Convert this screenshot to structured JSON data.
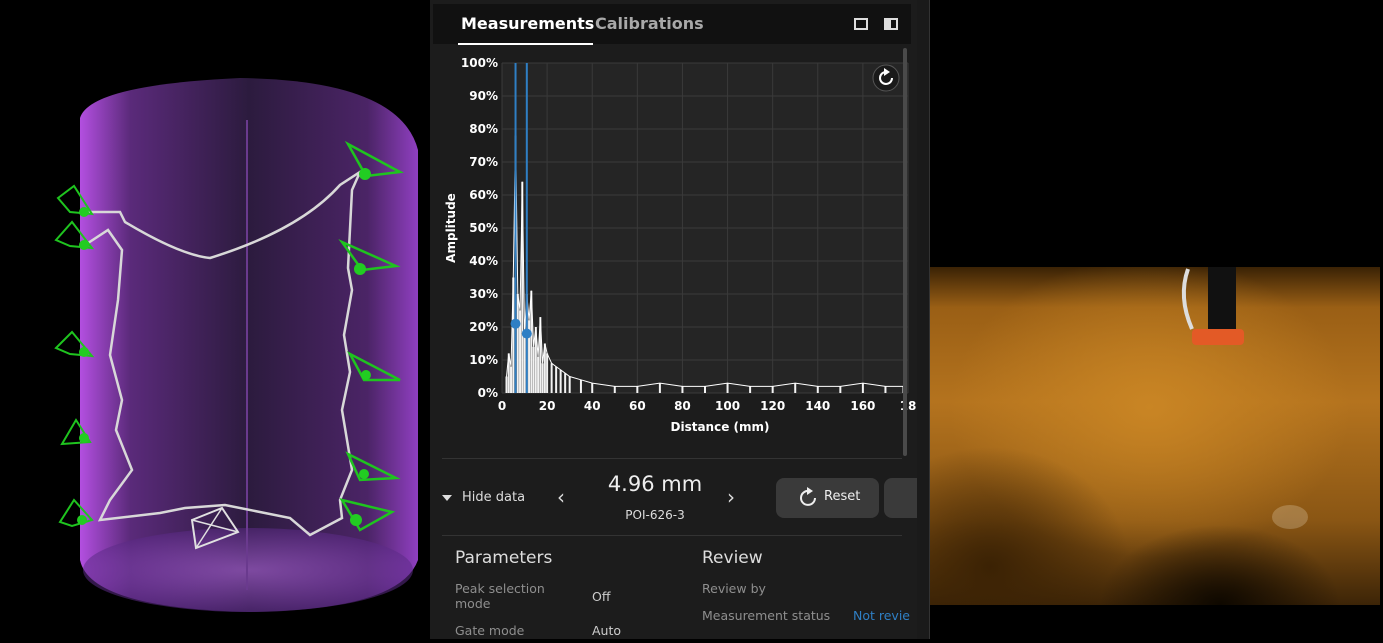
{
  "tabs": {
    "measurements": "Measurements",
    "calibrations": "Calibrations"
  },
  "chart_data": {
    "type": "line",
    "xlabel": "Distance (mm)",
    "ylabel": "Amplitude",
    "xlim": [
      0,
      180
    ],
    "ylim": [
      0,
      100
    ],
    "x_ticks": [
      "0",
      "20",
      "40",
      "60",
      "80",
      "100",
      "120",
      "140",
      "160",
      "18"
    ],
    "y_ticks": [
      "0%",
      "10%",
      "20%",
      "30%",
      "40%",
      "50%",
      "60%",
      "70%",
      "80%",
      "90%",
      "100%"
    ],
    "grid": true,
    "gate_lines_mm": [
      6,
      11
    ],
    "peaks": [
      {
        "x": 6,
        "y": 21
      },
      {
        "x": 11,
        "y": 18
      }
    ],
    "series": [
      {
        "x": [
          2,
          3,
          4,
          5,
          6,
          7,
          8,
          9,
          10,
          11,
          12,
          13,
          14,
          15,
          16,
          17,
          18,
          19,
          20,
          22,
          24,
          26,
          28,
          30,
          35,
          40,
          50,
          60,
          70,
          80,
          90,
          100,
          110,
          120,
          130,
          140,
          150,
          160,
          170,
          178
        ],
        "y": [
          5,
          12,
          8,
          35,
          78,
          30,
          25,
          64,
          18,
          30,
          22,
          31,
          14,
          20,
          11,
          23,
          9,
          15,
          12,
          9,
          8,
          7,
          6,
          5,
          4,
          3,
          2,
          2,
          3,
          2,
          2,
          3,
          2,
          2,
          3,
          2,
          2,
          3,
          2,
          2
        ]
      }
    ]
  },
  "measurement": {
    "value": "4.96 mm",
    "poi": "POI-626-3"
  },
  "controls": {
    "hide_data": "Hide data",
    "reset": "Reset"
  },
  "parameters": {
    "title": "Parameters",
    "peak_selection_label": "Peak selection mode",
    "peak_selection_value": "Off",
    "gate_mode_label": "Gate mode",
    "gate_mode_value": "Auto"
  },
  "review": {
    "title": "Review",
    "review_by_label": "Review by",
    "status_label": "Measurement status",
    "status_value": "Not reviewed"
  },
  "colors": {
    "accent": "#2f7fc4",
    "poi_green": "#22cc22",
    "pointcloud": "#8a2bbf"
  }
}
